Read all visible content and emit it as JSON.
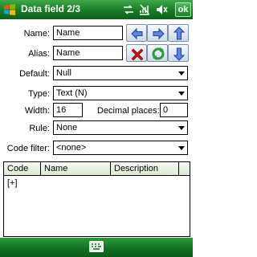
{
  "titlebar": {
    "title": "Data field 2/3",
    "ok_label": "ok"
  },
  "form": {
    "name_label": "Name:",
    "name_value": "Name",
    "alias_label": "Alias:",
    "alias_value": "Name",
    "default_label": "Default:",
    "default_value": "Null",
    "type_label": "Type:",
    "type_value": "Text (N)",
    "width_label": "Width:",
    "width_value": "16",
    "decimal_label": "Decimal places:",
    "decimal_value": "0",
    "rule_label": "Rule:",
    "rule_value": "None",
    "codefilter_label": "Code filter:",
    "codefilter_value": "<none>"
  },
  "grid": {
    "columns": [
      "Code",
      "Name",
      "Description"
    ],
    "rows": [
      "[+]"
    ]
  },
  "colors": {
    "title_green": "#177a25",
    "arrow_blue": "#3a62c6",
    "delete_red": "#d01010",
    "refresh_green": "#2e9a3c"
  }
}
